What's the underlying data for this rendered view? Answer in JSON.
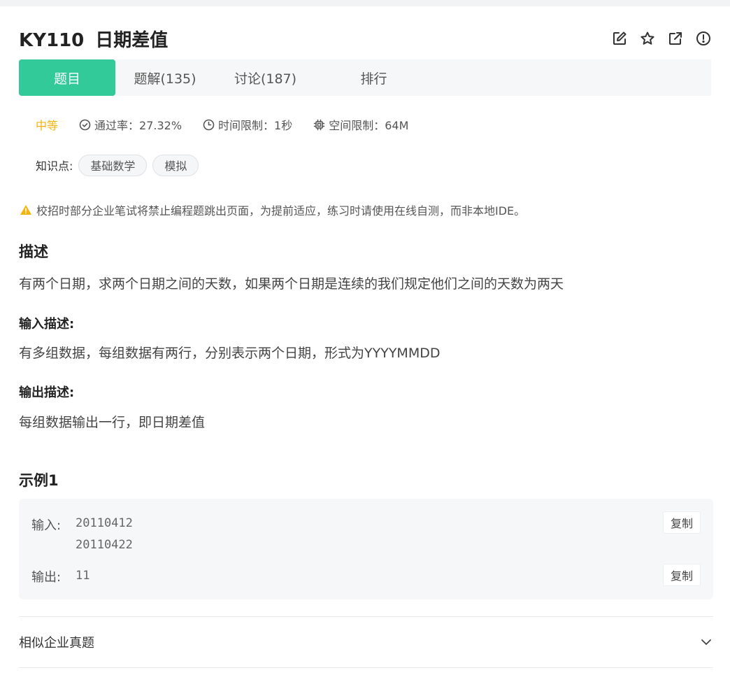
{
  "problem": {
    "code": "KY110",
    "title": "日期差值"
  },
  "header_icons": [
    "edit-icon",
    "star-icon",
    "external-link-icon",
    "report-icon"
  ],
  "tabs": [
    {
      "label": "题目",
      "active": true
    },
    {
      "label": "题解(135)",
      "active": false
    },
    {
      "label": "讨论(187)",
      "active": false
    },
    {
      "label": "排行",
      "active": false
    }
  ],
  "meta": {
    "difficulty": "中等",
    "pass_rate": "通过率：27.32%",
    "time_limit": "时间限制：1秒",
    "space_limit": "空间限制：64M"
  },
  "knowledge": {
    "label": "知识点:",
    "tags": [
      "基础数学",
      "模拟"
    ]
  },
  "notice": "校招时部分企业笔试将禁止编程题跳出页面，为提前适应，练习时请使用在线自测，而非本地IDE。",
  "description": {
    "heading": "描述",
    "text": "有两个日期，求两个日期之间的天数，如果两个日期是连续的我们规定他们之间的天数为两天"
  },
  "input_desc": {
    "heading": "输入描述:",
    "text": "有多组数据，每组数据有两行，分别表示两个日期，形式为YYYYMMDD"
  },
  "output_desc": {
    "heading": "输出描述:",
    "text": "每组数据输出一行，即日期差值"
  },
  "example": {
    "heading": "示例1",
    "input_label": "输入:",
    "input_value": "20110412\n20110422",
    "output_label": "输出:",
    "output_value": "11",
    "copy_label": "复制"
  },
  "similar": {
    "label": "相似企业真题"
  },
  "colors": {
    "accent": "#32ca99",
    "difficulty": "#f2b40f",
    "warning": "#f2b40f"
  }
}
